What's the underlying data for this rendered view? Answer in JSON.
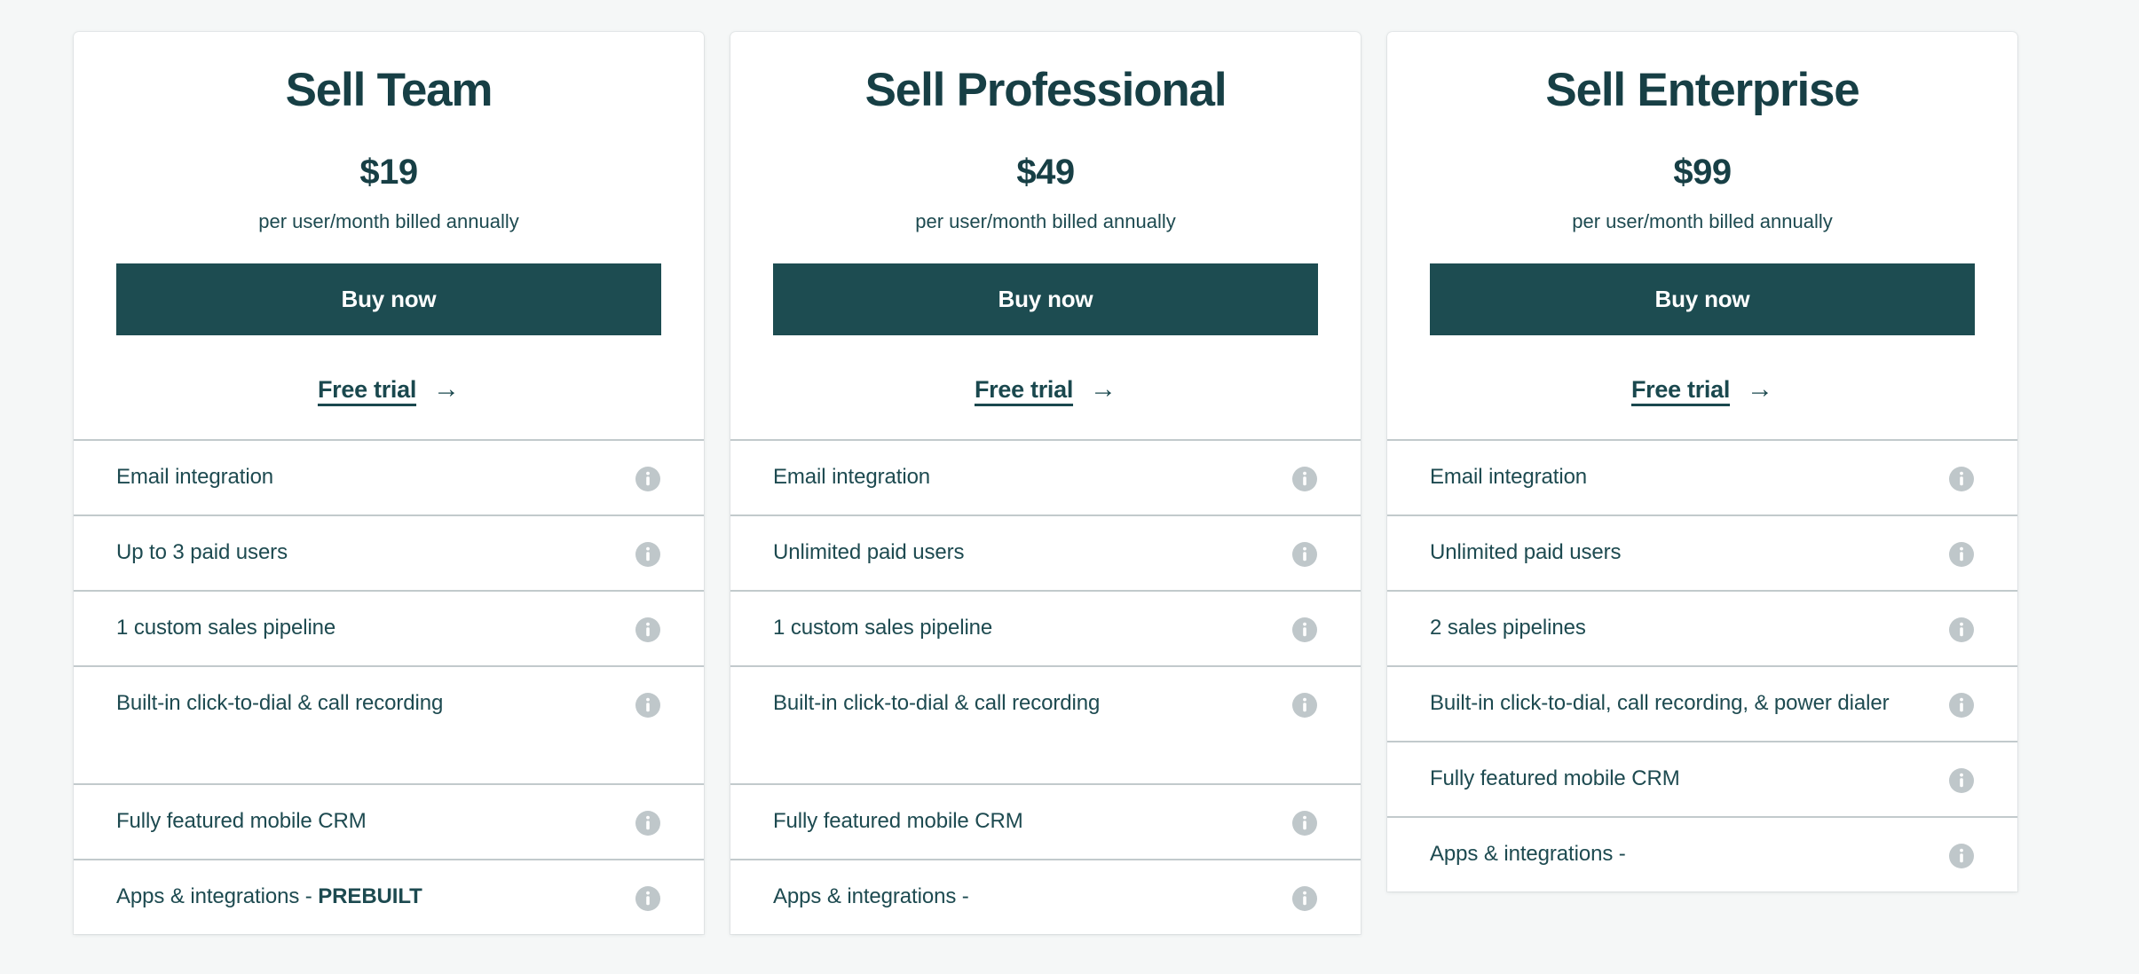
{
  "theme": {
    "page_background": "#f5f7f7",
    "card_background": "#ffffff",
    "accent_teal": "#1d4c51",
    "text_teal": "#1d4a50",
    "heading_teal": "#173f45",
    "divider": "#c2cacc",
    "info_icon": "#bfc7ca"
  },
  "plans": [
    {
      "title": "Sell Team",
      "price": "$19",
      "period": "per user/month billed annually",
      "buy_label": "Buy now",
      "trial_label": "Free trial",
      "trial_arrow": "→",
      "info_icon_name": "info-icon",
      "features": [
        {
          "text": "Email integration",
          "bold": "",
          "tall": false
        },
        {
          "text": "Up to 3 paid users",
          "bold": "",
          "tall": false
        },
        {
          "text": "1 custom sales pipeline",
          "bold": "",
          "tall": false
        },
        {
          "text": "Built-in click-to-dial & call recording",
          "bold": "",
          "tall": true
        },
        {
          "text": "Fully featured mobile CRM",
          "bold": "",
          "tall": false
        },
        {
          "text": "Apps & integrations - ",
          "bold": "PREBUILT",
          "tall": false
        }
      ]
    },
    {
      "title": "Sell Professional",
      "price": "$49",
      "period": "per user/month billed annually",
      "buy_label": "Buy now",
      "trial_label": "Free trial",
      "trial_arrow": "→",
      "info_icon_name": "info-icon",
      "features": [
        {
          "text": "Email integration",
          "bold": "",
          "tall": false
        },
        {
          "text": "Unlimited paid users",
          "bold": "",
          "tall": false
        },
        {
          "text": "1 custom sales pipeline",
          "bold": "",
          "tall": false
        },
        {
          "text": "Built-in click-to-dial & call recording",
          "bold": "",
          "tall": true
        },
        {
          "text": "Fully featured mobile CRM",
          "bold": "",
          "tall": false
        },
        {
          "text": "Apps & integrations - ",
          "bold": "",
          "tall": false
        }
      ]
    },
    {
      "title": "Sell Enterprise",
      "price": "$99",
      "period": "per user/month billed annually",
      "buy_label": "Buy now",
      "trial_label": "Free trial",
      "trial_arrow": "→",
      "info_icon_name": "info-icon",
      "features": [
        {
          "text": "Email integration",
          "bold": "",
          "tall": false
        },
        {
          "text": "Unlimited paid users",
          "bold": "",
          "tall": false
        },
        {
          "text": "2 sales pipelines",
          "bold": "",
          "tall": false
        },
        {
          "text": "Built-in click-to-dial, call recording, & power dialer",
          "bold": "",
          "tall": false
        },
        {
          "text": "Fully featured mobile CRM",
          "bold": "",
          "tall": false
        },
        {
          "text": "Apps & integrations - ",
          "bold": "",
          "tall": false
        }
      ]
    }
  ]
}
